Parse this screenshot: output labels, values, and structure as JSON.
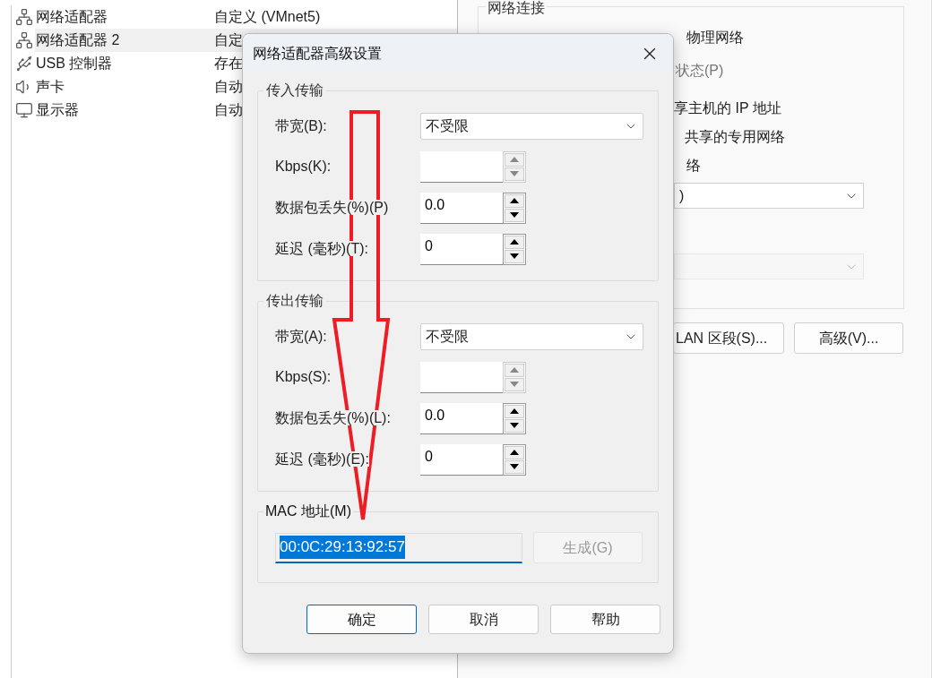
{
  "background": {
    "devices": [
      {
        "kind": "network",
        "name": "网络适配器",
        "summary": "自定义 (VMnet5)",
        "selected": false
      },
      {
        "kind": "network",
        "name": "网络适配器 2",
        "summary": "自定",
        "selected": true
      },
      {
        "kind": "usb",
        "name": "USB 控制器",
        "summary": "存在",
        "selected": false
      },
      {
        "kind": "speaker",
        "name": "声卡",
        "summary": "自动",
        "selected": false
      },
      {
        "kind": "monitor",
        "name": "显示器",
        "summary": "自动",
        "selected": false
      }
    ],
    "network_connection": {
      "legend": "网络连接",
      "options": [
        {
          "text": "物理网络",
          "disabled": false
        },
        {
          "text": "状态(P)",
          "disabled": true
        },
        {
          "text": "享主机的 IP 地址",
          "disabled": false
        },
        {
          "text": "共享的专用网络",
          "disabled": false
        },
        {
          "text": "络",
          "disabled": false
        }
      ],
      "dropdown": {
        "value": ")",
        "disabled": false
      },
      "dropdown_2": {
        "disabled": true
      }
    },
    "buttons": [
      {
        "label": "LAN 区段(S)..."
      },
      {
        "label": "高级(V)..."
      }
    ]
  },
  "dialog": {
    "title": "网络适配器高级设置",
    "groups": [
      {
        "legend": "传入传输",
        "rows": [
          {
            "kind": "dropdown",
            "label": "带宽(B):",
            "value": "不受限"
          },
          {
            "kind": "spin",
            "label": "Kbps(K):",
            "disabled": true
          },
          {
            "kind": "spin",
            "label": "数据包丢失(%)(P)",
            "value": "0.0",
            "disabled": false
          },
          {
            "kind": "spin",
            "label": "延迟 (毫秒)(T):",
            "value": "0",
            "disabled": false
          }
        ]
      },
      {
        "legend": "传出传输",
        "rows": [
          {
            "kind": "dropdown",
            "label": "带宽(A):",
            "value": "不受限"
          },
          {
            "kind": "spin",
            "label": "Kbps(S):",
            "disabled": true
          },
          {
            "kind": "spin",
            "label": "数据包丢失(%)(L):",
            "value": "0.0",
            "disabled": false
          },
          {
            "kind": "spin",
            "label": "延迟 (毫秒)(E):",
            "value": "0",
            "disabled": false
          }
        ]
      }
    ],
    "mac": {
      "legend": "MAC 地址(M)",
      "value": "00:0C:29:13:92:57",
      "selected": true,
      "generate": {
        "label": "生成(G)",
        "disabled": true
      }
    },
    "buttons": [
      {
        "label": "确定",
        "default": true
      },
      {
        "label": "取消",
        "default": false
      },
      {
        "label": "帮助",
        "default": false
      }
    ]
  },
  "annotation": {
    "kind": "arrow"
  }
}
